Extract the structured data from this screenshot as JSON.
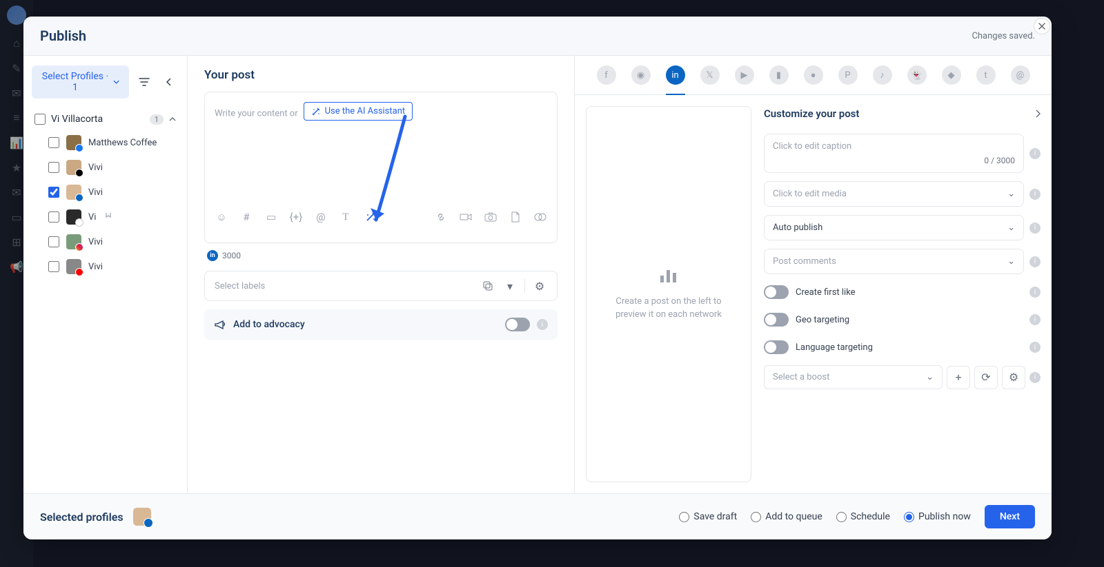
{
  "modal": {
    "title": "Publish",
    "saved_status": "Changes saved."
  },
  "left": {
    "select_profiles_label": "Select Profiles · 1",
    "group_name": "Vi Villacorta",
    "group_count": "1",
    "profiles": [
      {
        "name": "Matthews Coffee",
        "checked": false,
        "badge_color": "#1877f2"
      },
      {
        "name": "Vivi",
        "checked": false,
        "badge_color": "#000000"
      },
      {
        "name": "Vivi",
        "checked": true,
        "badge_color": "#0a66c2"
      },
      {
        "name": "Vi",
        "checked": false,
        "badge_color": "#ffffff"
      },
      {
        "name": "Vivi",
        "checked": false,
        "badge_color": "#e1306c"
      },
      {
        "name": "Vivi",
        "checked": false,
        "badge_color": "#ff0000"
      }
    ]
  },
  "center": {
    "heading": "Your post",
    "placeholder": "Write your content or",
    "ai_button": "Use the AI Assistant",
    "char_limit": "3000",
    "labels_placeholder": "Select labels",
    "advocacy_label": "Add to advocacy"
  },
  "right": {
    "preview_hint": "Create a post on the left to preview it on each network",
    "customize_heading": "Customize your post",
    "caption_placeholder": "Click to edit caption",
    "caption_counter": "0 / 3000",
    "media_placeholder": "Click to edit media",
    "publish_mode": "Auto publish",
    "comments_placeholder": "Post comments",
    "toggles": {
      "first_like": "Create first like",
      "geo": "Geo targeting",
      "language": "Language targeting"
    },
    "boost_placeholder": "Select a boost"
  },
  "footer": {
    "selected_label": "Selected profiles",
    "options": {
      "draft": "Save draft",
      "queue": "Add to queue",
      "schedule": "Schedule",
      "now": "Publish now"
    },
    "next_button": "Next"
  }
}
